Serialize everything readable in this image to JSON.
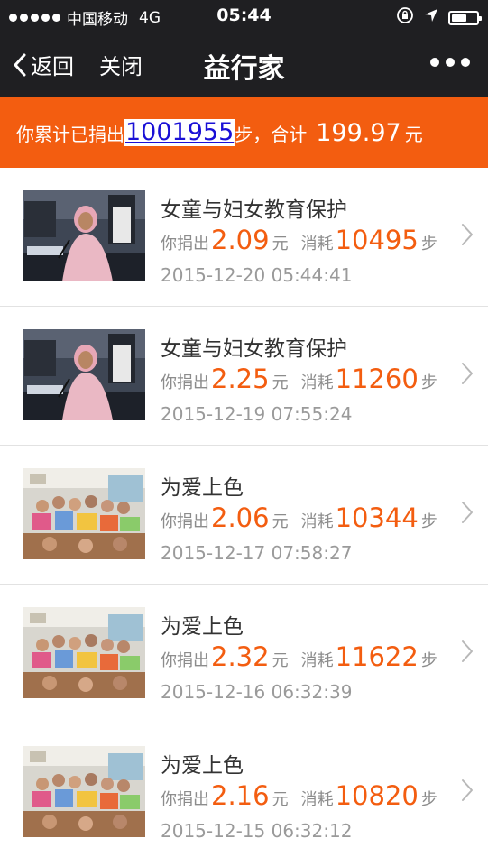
{
  "status_bar": {
    "carrier": "中国移动",
    "network": "4G",
    "time": "05:44",
    "icons": [
      "signal-dots-icon",
      "orientation-lock-icon",
      "location-icon",
      "battery-icon"
    ]
  },
  "nav": {
    "back_label": "返回",
    "close_label": "关闭",
    "title": "益行家",
    "more_icon": "more-dots-icon"
  },
  "summary": {
    "prefix": "你累计已捐出",
    "steps": "1001955",
    "middle": "步，合计",
    "amount": "199.97",
    "unit": "元"
  },
  "labels": {
    "donated": "你捐出",
    "yuan": "元",
    "consumed": "消耗",
    "steps": "步"
  },
  "donations": [
    {
      "title": "女童与妇女教育保护",
      "amount": "2.09",
      "steps": "10495",
      "date": "2015-12-20 05:44:41",
      "image": "speaker-at-un-photo"
    },
    {
      "title": "女童与妇女教育保护",
      "amount": "2.25",
      "steps": "11260",
      "date": "2015-12-19 07:55:24",
      "image": "speaker-at-un-photo"
    },
    {
      "title": "为爱上色",
      "amount": "2.06",
      "steps": "10344",
      "date": "2015-12-17 07:58:27",
      "image": "classroom-children-photo"
    },
    {
      "title": "为爱上色",
      "amount": "2.32",
      "steps": "11622",
      "date": "2015-12-16 06:32:39",
      "image": "classroom-children-photo"
    },
    {
      "title": "为爱上色",
      "amount": "2.16",
      "steps": "10820",
      "date": "2015-12-15 06:32:12",
      "image": "classroom-children-photo"
    }
  ],
  "colors": {
    "accent": "#f35d10",
    "nav_bg": "#1f1f22",
    "link": "#1a10d6"
  }
}
